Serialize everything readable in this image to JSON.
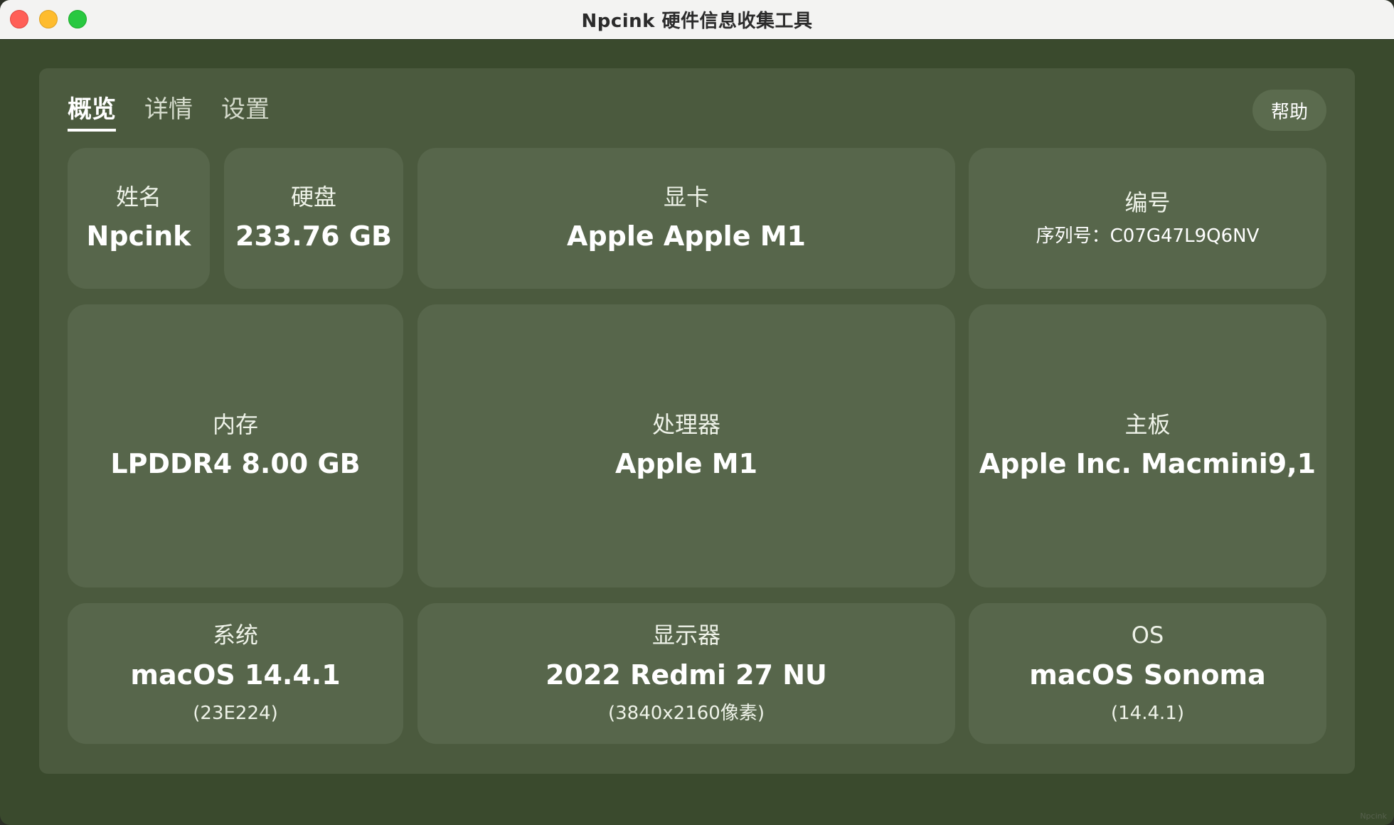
{
  "window": {
    "title": "Npcink 硬件信息收集工具"
  },
  "tabs": [
    {
      "label": "概览",
      "active": true
    },
    {
      "label": "详情",
      "active": false
    },
    {
      "label": "设置",
      "active": false
    }
  ],
  "help_label": "帮助",
  "cards": {
    "name": {
      "label": "姓名",
      "value": "Npcink"
    },
    "disk": {
      "label": "硬盘",
      "value": "233.76 GB"
    },
    "gpu": {
      "label": "显卡",
      "value": "Apple Apple M1"
    },
    "serial": {
      "label": "编号",
      "value": "序列号：C07G47L9Q6NV"
    },
    "memory": {
      "label": "内存",
      "value": "LPDDR4 8.00 GB"
    },
    "cpu": {
      "label": "处理器",
      "value": "Apple M1"
    },
    "board": {
      "label": "主板",
      "value": "Apple Inc. Macmini9,1"
    },
    "system": {
      "label": "系统",
      "value": "macOS 14.4.1",
      "sub": "(23E224)"
    },
    "display": {
      "label": "显示器",
      "value": "2022 Redmi 27 NU",
      "sub": "(3840x2160像素)"
    },
    "os": {
      "label": "OS",
      "value": "macOS Sonoma",
      "sub": "(14.4.1)"
    }
  },
  "watermark": "Npcink",
  "colors": {
    "background": "#3a4a2d",
    "panel": "#4b5a3e",
    "card": "#57664b",
    "close": "#ff5f57",
    "minimize": "#febc2e",
    "maximize": "#28c840"
  }
}
